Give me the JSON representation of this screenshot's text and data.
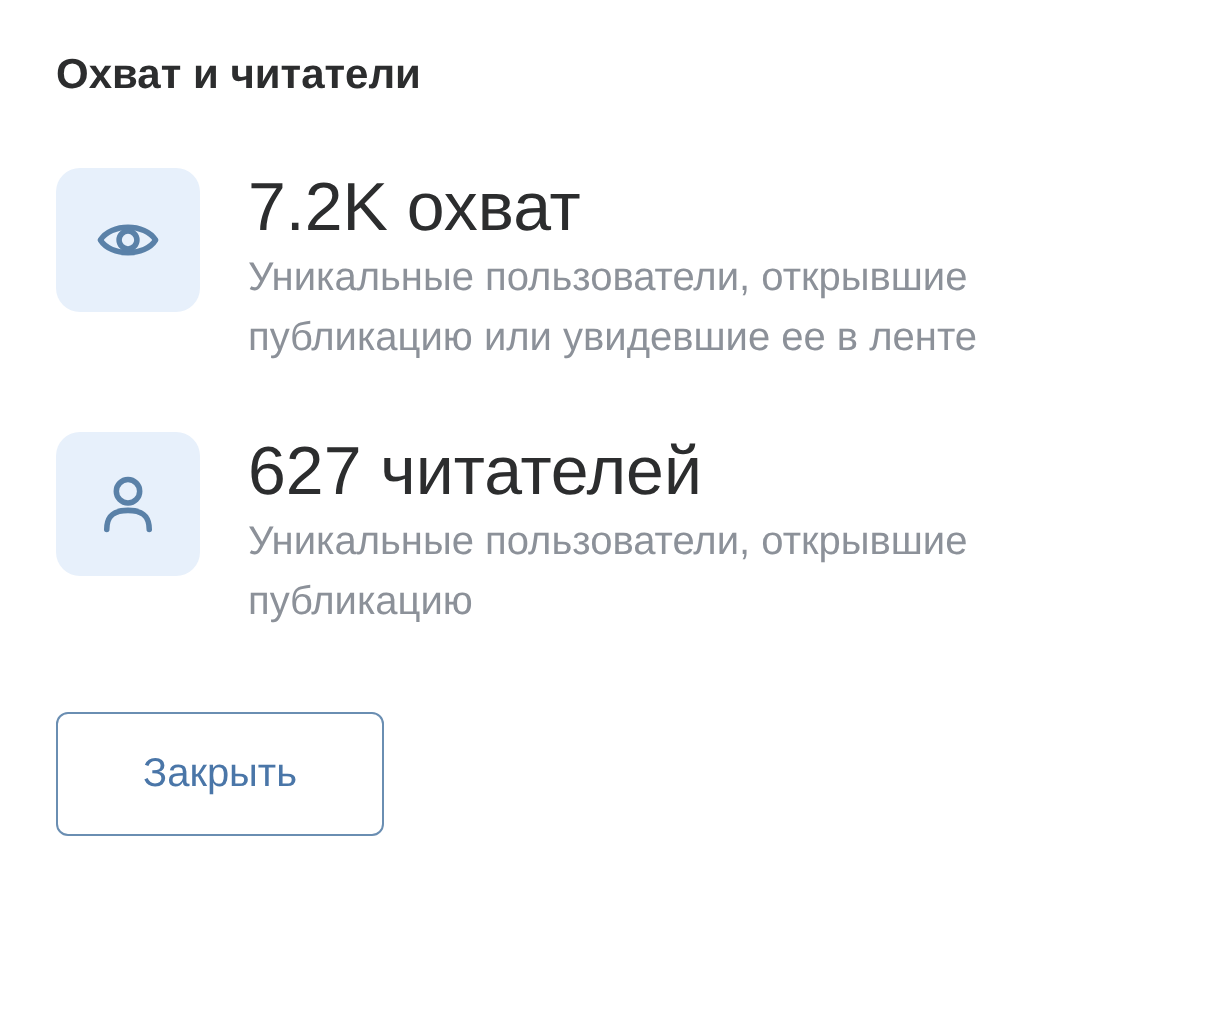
{
  "title": "Охват и читатели",
  "stats": [
    {
      "kind": "reach",
      "value": "7.2K охват",
      "description": "Уникальные пользователи, открывшие публикацию или увидевшие ее в ленте"
    },
    {
      "kind": "readers",
      "value": "627 читателей",
      "description": "Уникальные пользователи, открывшие публикацию"
    }
  ],
  "button": "Закрыть"
}
